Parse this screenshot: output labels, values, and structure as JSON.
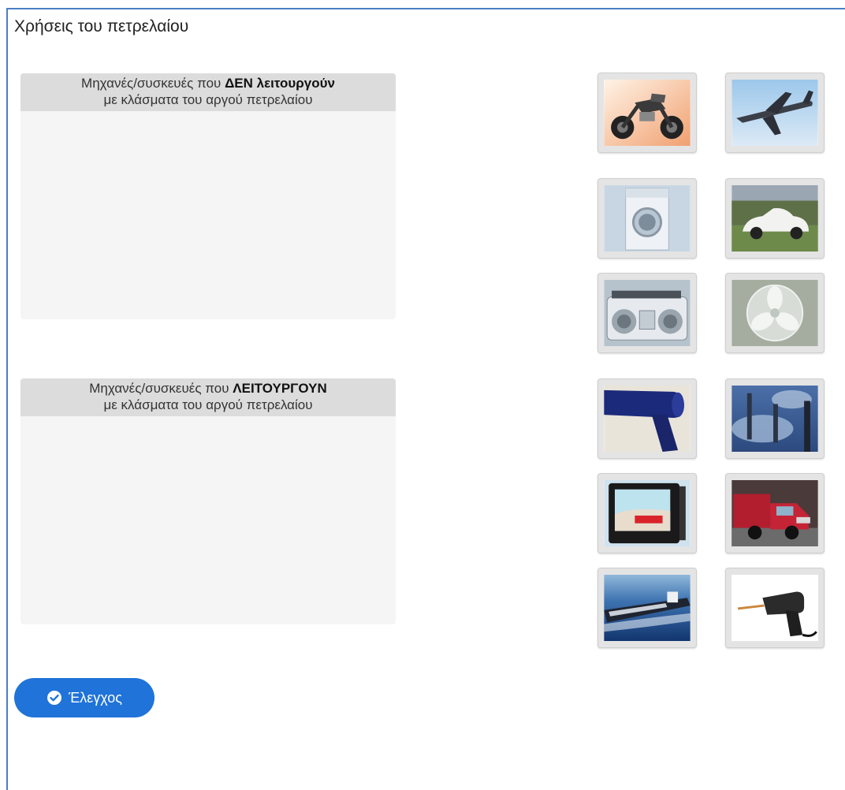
{
  "title": "Χρήσεις του πετρελαίου",
  "zones": [
    {
      "prefix": "Μηχανές/συσκευές που ",
      "bold": "ΔΕΝ λειτουργούν",
      "line2": "με κλάσματα του αργού πετρελαίου"
    },
    {
      "prefix": "Μηχανές/συσκευές που ",
      "bold": "ΛΕΙΤΟΥΡΓΟΥΝ",
      "line2": "με κλάσματα του αργού πετρελαίου"
    }
  ],
  "items": [
    {
      "name": "motorcycle-icon"
    },
    {
      "name": "airplane-icon"
    },
    {
      "name": "washing-machine-icon"
    },
    {
      "name": "car-icon"
    },
    {
      "name": "radio-cassette-icon"
    },
    {
      "name": "fan-icon"
    },
    {
      "name": "hair-dryer-icon"
    },
    {
      "name": "factory-smoke-icon"
    },
    {
      "name": "television-icon"
    },
    {
      "name": "truck-icon"
    },
    {
      "name": "ship-icon"
    },
    {
      "name": "drill-icon"
    }
  ],
  "check_button": {
    "label": "Έλεγχος",
    "color": "#1f73d9"
  }
}
